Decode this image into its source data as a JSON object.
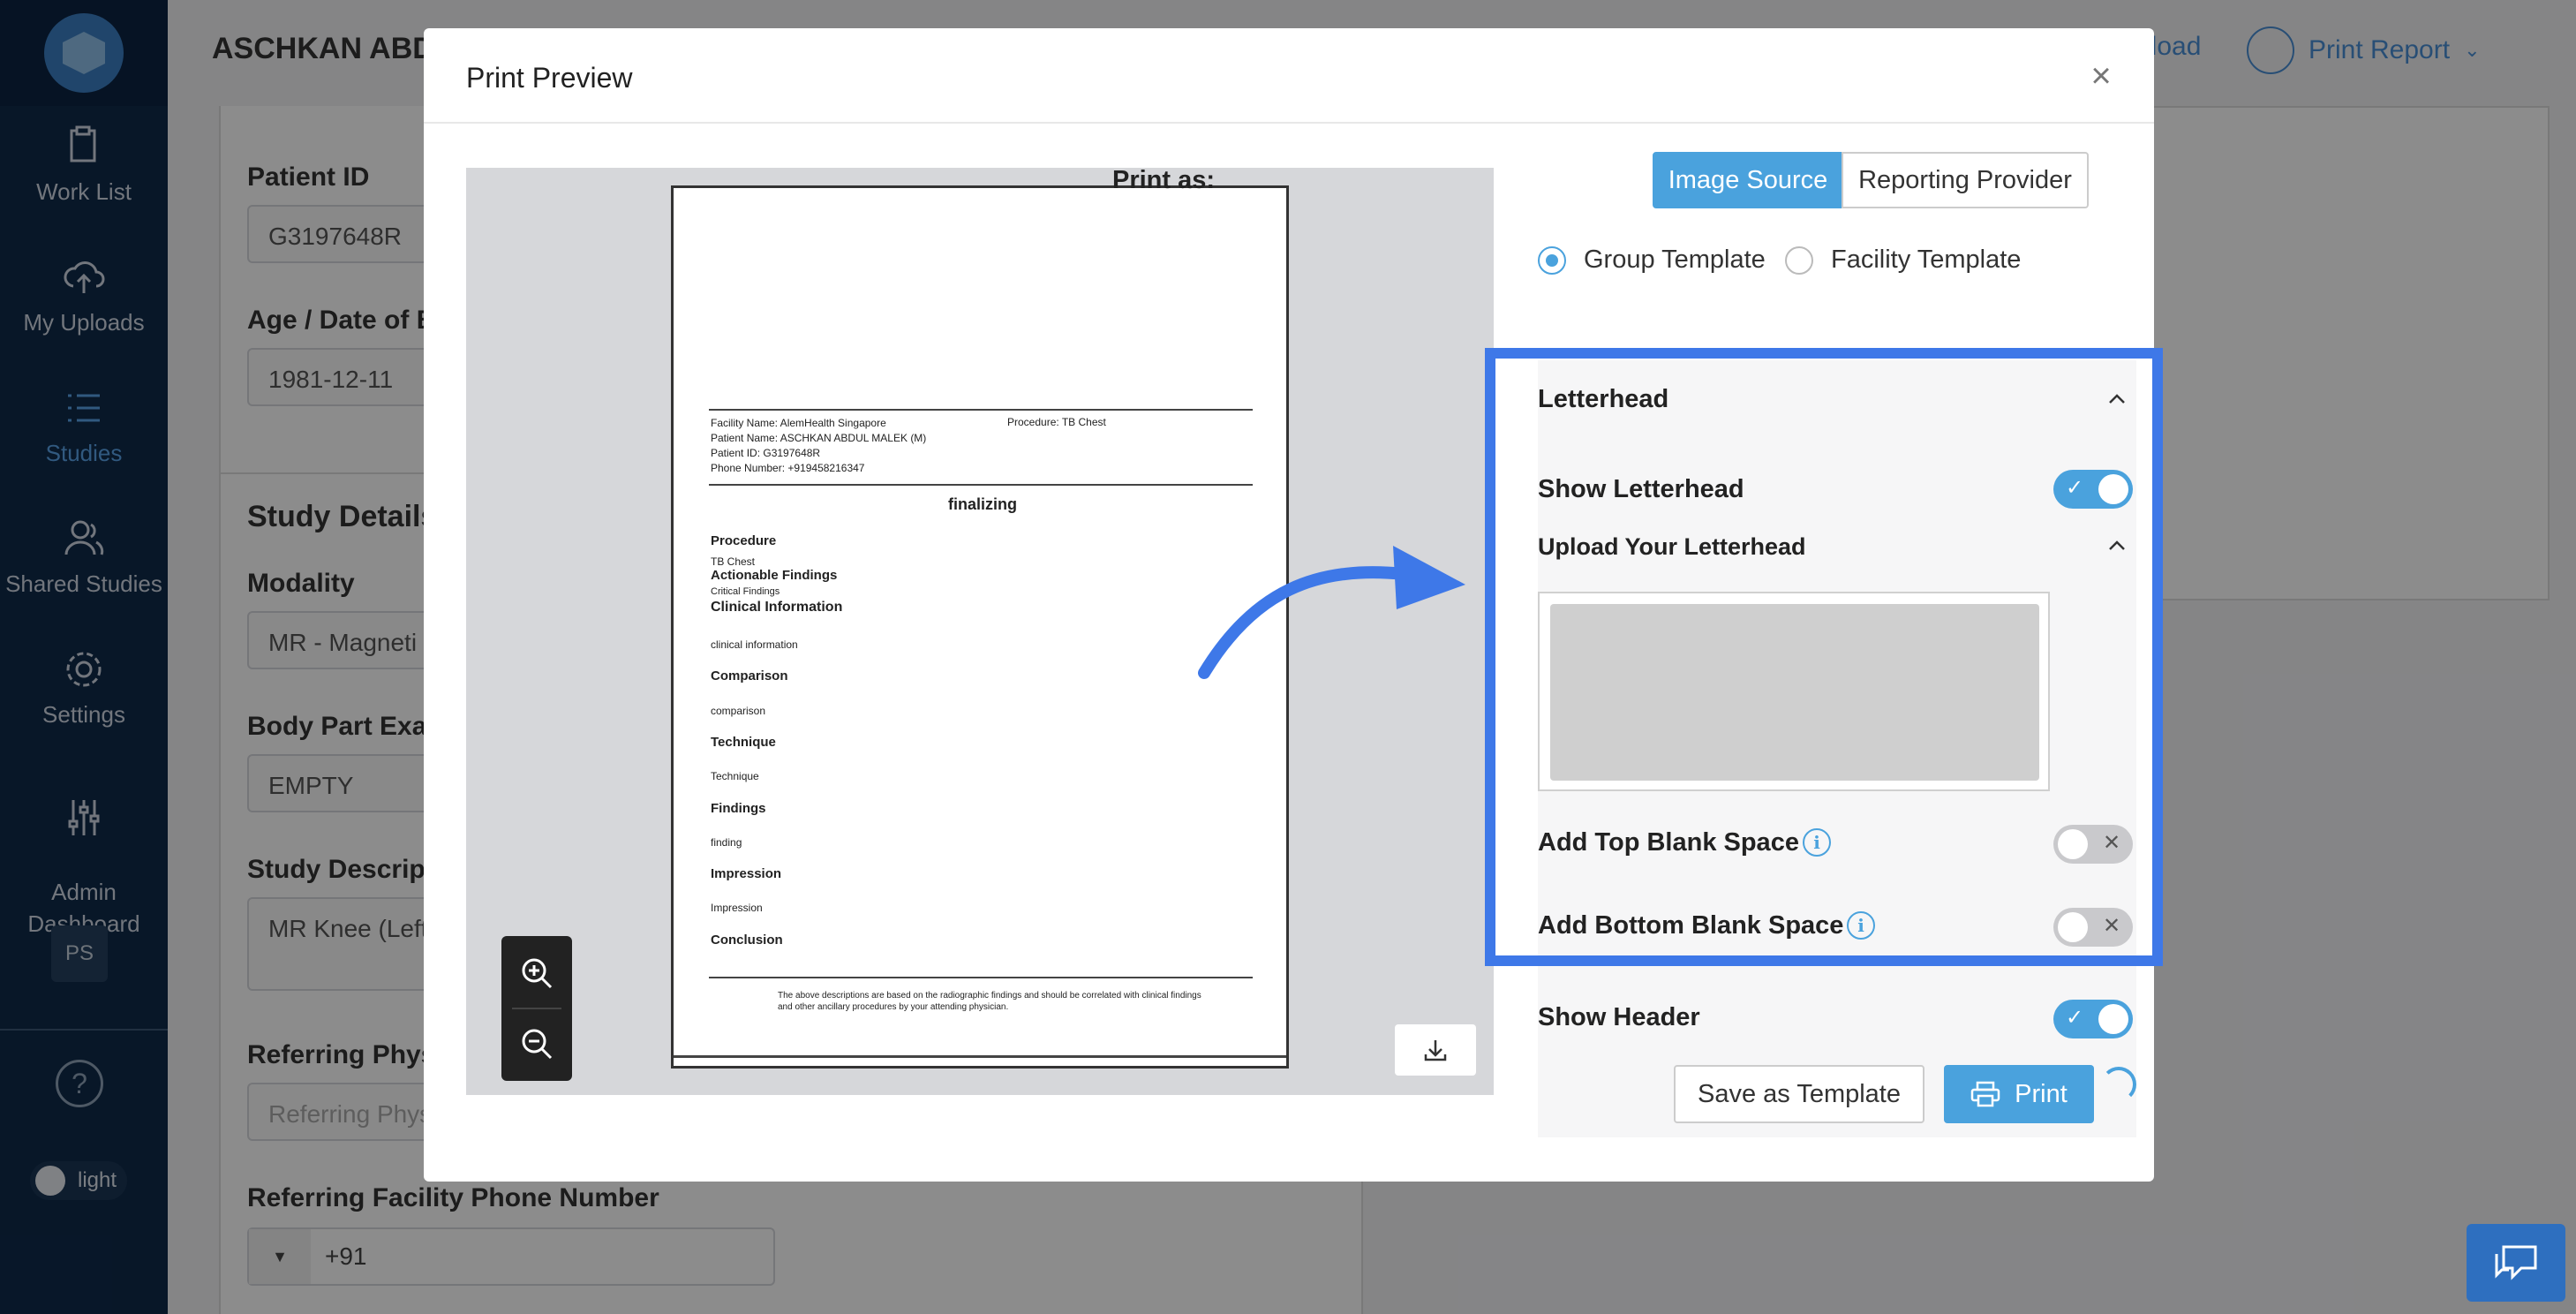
{
  "sidebar": {
    "items": [
      {
        "label": "Work List",
        "icon": "clipboard-icon"
      },
      {
        "label": "My Uploads",
        "icon": "cloud-upload-icon"
      },
      {
        "label": "Studies",
        "icon": "list-icon",
        "active": true
      },
      {
        "label": "Shared Studies",
        "icon": "users-icon"
      },
      {
        "label": "Settings",
        "icon": "gear-icon"
      },
      {
        "label": "Admin\nDashboard",
        "icon": "sliders-icon"
      }
    ],
    "badge": "PS",
    "help": "?",
    "theme_label": "light"
  },
  "header": {
    "patient_name": "ASCHKAN ABDU",
    "download_label": "nload",
    "print_report_label": "Print Report"
  },
  "background_form": {
    "patient_id_label": "Patient ID",
    "patient_id_value": "G3197648R",
    "age_label": "Age / Date of B",
    "age_value": "1981-12-11",
    "study_details_heading": "Study Details",
    "modality_label": "Modality",
    "modality_value": "MR - Magneti",
    "body_part_label": "Body Part Exar",
    "body_part_value": "EMPTY",
    "study_desc_label": "Study Descripti",
    "study_desc_value": "MR Knee (Left",
    "referring_phys_label": "Referring Physi",
    "referring_phys_placeholder": "Referring Phys",
    "ref_facility_phone_label": "Referring Facility Phone Number",
    "phone_prefix": "+91"
  },
  "modal": {
    "title": "Print Preview",
    "print_as_label": "Print as:",
    "print_as_options": [
      "Image Source",
      "Reporting Provider"
    ],
    "print_as_selected": "Image Source",
    "template_options": [
      "Group Template",
      "Facility Template"
    ],
    "template_selected": "Group Template",
    "letterhead_heading": "Letterhead",
    "show_letterhead_label": "Show Letterhead",
    "show_letterhead": true,
    "upload_letterhead_label": "Upload Your Letterhead",
    "add_top_blank_label": "Add Top Blank Space",
    "add_top_blank": false,
    "add_bottom_blank_label": "Add Bottom Blank Space",
    "add_bottom_blank": false,
    "show_header_label": "Show Header",
    "show_header": true,
    "save_template_label": "Save as Template",
    "print_label": "Print",
    "highlight_color": "#3e78e8",
    "accent_color": "#4aa2dd"
  },
  "report": {
    "facility_line": "Facility Name: AlemHealth Singapore",
    "procedure_line": "Procedure: TB Chest",
    "patient_name_line": "Patient Name: ASCHKAN ABDUL MALEK (M)",
    "patient_id_line": "Patient ID: G3197648R",
    "phone_line": "Phone Number: +919458216347",
    "status": "finalizing",
    "sections": [
      {
        "heading": "Procedure",
        "body": "TB Chest"
      },
      {
        "heading": "Actionable Findings",
        "body": "Critical Findings"
      },
      {
        "heading": "Clinical Information",
        "body": "clinical information"
      },
      {
        "heading": "Comparison",
        "body": "comparison"
      },
      {
        "heading": "Technique",
        "body": "Technique"
      },
      {
        "heading": "Findings",
        "body": "finding"
      },
      {
        "heading": "Impression",
        "body": "Impression"
      },
      {
        "heading": "Conclusion",
        "body": ""
      }
    ],
    "footer": "The above descriptions are based on the radiographic findings and should be correlated with clinical findings and other ancillary procedures by your attending physician."
  }
}
